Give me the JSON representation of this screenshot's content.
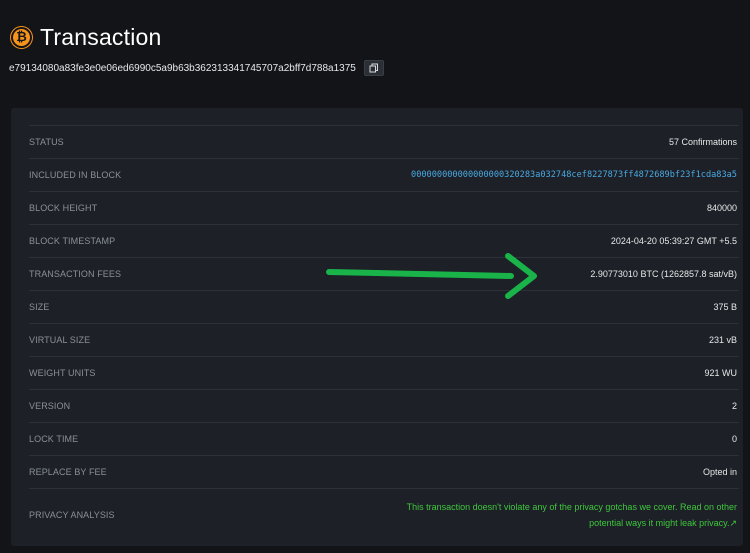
{
  "header": {
    "title": "Transaction",
    "txid": "e79134080a83fe3e0e06ed6990c5a9b63b362313341745707a2bff7d788a1375",
    "icon": "bitcoin-icon",
    "copy_icon": "copy-icon"
  },
  "details": [
    {
      "label": "STATUS",
      "value": "57 Confirmations"
    },
    {
      "label": "INCLUDED IN BLOCK",
      "value": "000000000000000000320283a032748cef8227873ff4872689bf23f1cda83a5"
    },
    {
      "label": "BLOCK HEIGHT",
      "value": "840000"
    },
    {
      "label": "BLOCK TIMESTAMP",
      "value": "2024-04-20 05:39:27 GMT +5.5"
    },
    {
      "label": "TRANSACTION FEES",
      "value": "2.90773010 BTC (1262857.8 sat/vB)"
    },
    {
      "label": "SIZE",
      "value": "375 B"
    },
    {
      "label": "VIRTUAL SIZE",
      "value": "231 vB"
    },
    {
      "label": "WEIGHT UNITS",
      "value": "921 WU"
    },
    {
      "label": "VERSION",
      "value": "2"
    },
    {
      "label": "LOCK TIME",
      "value": "0"
    },
    {
      "label": "REPLACE BY FEE",
      "value": "Opted in"
    },
    {
      "label": "PRIVACY ANALYSIS",
      "value": "This transaction doesn't violate any of the privacy gotchas we cover. Read on other potential ways it might leak privacy.↗"
    }
  ],
  "colors": {
    "background": "#131418",
    "panel": "#1d2026",
    "link": "#4aa9e2",
    "privacy_text": "#3ec73e",
    "arrow": "#19b34a",
    "bitcoin": "#f7931a"
  }
}
